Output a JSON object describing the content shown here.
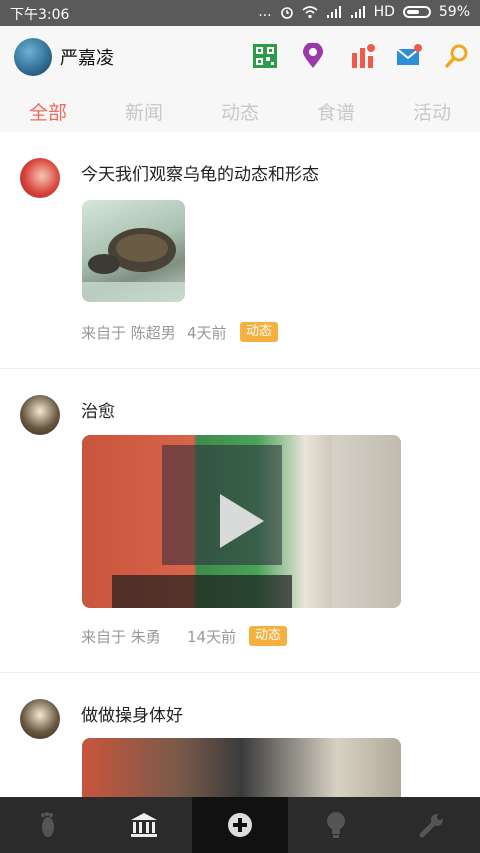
{
  "status_bar": {
    "time": "下午3:06",
    "dots": "...",
    "network_label": "HD",
    "battery_percent": "59%",
    "battery_level": 0.59
  },
  "header": {
    "username": "严嘉凌",
    "icons": [
      "qr-icon",
      "location-icon",
      "chart-icon",
      "mail-icon",
      "search-icon"
    ]
  },
  "tabs": [
    {
      "label": "全部",
      "active": true
    },
    {
      "label": "新闻",
      "active": false
    },
    {
      "label": "动态",
      "active": false
    },
    {
      "label": "食谱",
      "active": false
    },
    {
      "label": "活动",
      "active": false
    }
  ],
  "posts": [
    {
      "title": "今天我们观察乌龟的动态和形态",
      "from": "来自于 陈超男",
      "time": "4天前",
      "tag": "动态"
    },
    {
      "title": "治愈",
      "from": "来自于 朱勇",
      "time": "14天前",
      "tag": "动态"
    },
    {
      "title": "做做操身体好"
    }
  ],
  "colors": {
    "accent": "#ef6a5c",
    "badge": "#f6b040",
    "nav_bg": "#2b2b2b"
  },
  "bottom_nav": [
    "footprint-icon",
    "bank-icon",
    "add-icon",
    "bulb-icon",
    "wrench-icon"
  ]
}
